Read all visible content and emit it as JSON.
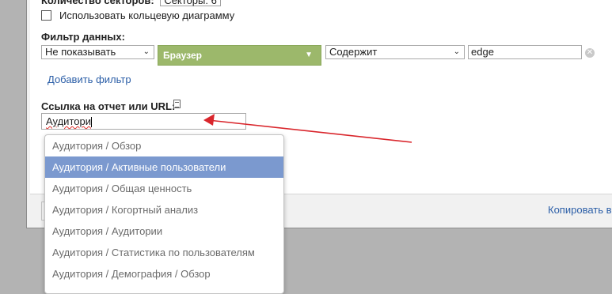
{
  "top": {
    "sectors_label": "Количество секторов:",
    "sectors_value": "Секторы: 6"
  },
  "donut": {
    "label": "Использовать кольцевую диаграмму",
    "checked": false
  },
  "filter": {
    "label": "Фильтр данных:",
    "show_select": "Не показывать",
    "dimension_select": "Браузер",
    "condition_select": "Содержит",
    "value": "edge",
    "add_link": "Добавить фильтр"
  },
  "link": {
    "label": "Ссылка на отчет или URL:",
    "value": "Аудитори"
  },
  "suggestions": [
    "Аудитория / Обзор",
    "Аудитория / Активные пользователи",
    "Аудитория / Общая ценность",
    "Аудитория / Когортный анализ",
    "Аудитория / Аудитории",
    "Аудитория / Статистика по пользователям",
    "Аудитория / Демография / Обзор"
  ],
  "footer": {
    "copy_link": "Копировать в"
  },
  "colors": {
    "accent_green": "#9cb86b",
    "highlight": "#7b99cf",
    "annotation_arrow": "#d9262c",
    "link": "#2b5ea7"
  }
}
